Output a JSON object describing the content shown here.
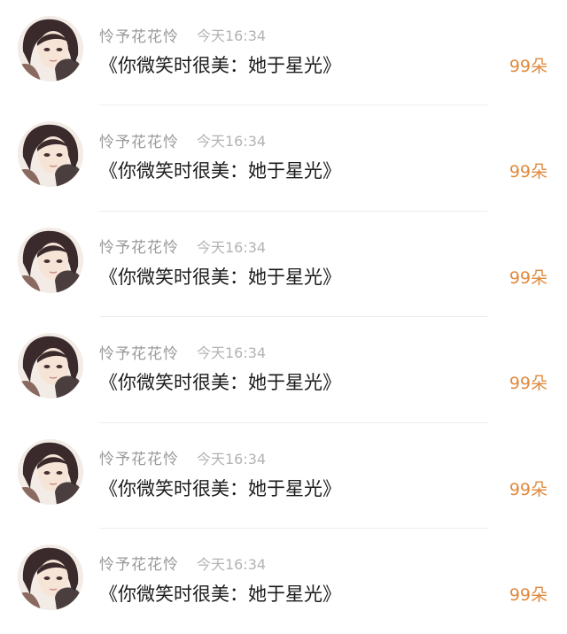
{
  "items": [
    {
      "username": "怜予花花怜",
      "time": "今天16:34",
      "title": "《你微笑时很美：她于星光》",
      "count": "99朵",
      "avatar_icon": "anime-portrait-avatar"
    },
    {
      "username": "怜予花花怜",
      "time": "今天16:34",
      "title": "《你微笑时很美：她于星光》",
      "count": "99朵",
      "avatar_icon": "anime-portrait-avatar"
    },
    {
      "username": "怜予花花怜",
      "time": "今天16:34",
      "title": "《你微笑时很美：她于星光》",
      "count": "99朵",
      "avatar_icon": "anime-portrait-avatar"
    },
    {
      "username": "怜予花花怜",
      "time": "今天16:34",
      "title": "《你微笑时很美：她于星光》",
      "count": "99朵",
      "avatar_icon": "anime-portrait-avatar"
    },
    {
      "username": "怜予花花怜",
      "time": "今天16:34",
      "title": "《你微笑时很美：她于星光》",
      "count": "99朵",
      "avatar_icon": "anime-portrait-avatar"
    },
    {
      "username": "怜予花花怜",
      "time": "今天16:34",
      "title": "《你微笑时很美：她于星光》",
      "count": "99朵",
      "avatar_icon": "anime-portrait-avatar"
    }
  ],
  "colors": {
    "username": "#9a9a9a",
    "time": "#b3b3b3",
    "title": "#1b1b1b",
    "count": "#e08a3e",
    "divider": "#ededed"
  }
}
